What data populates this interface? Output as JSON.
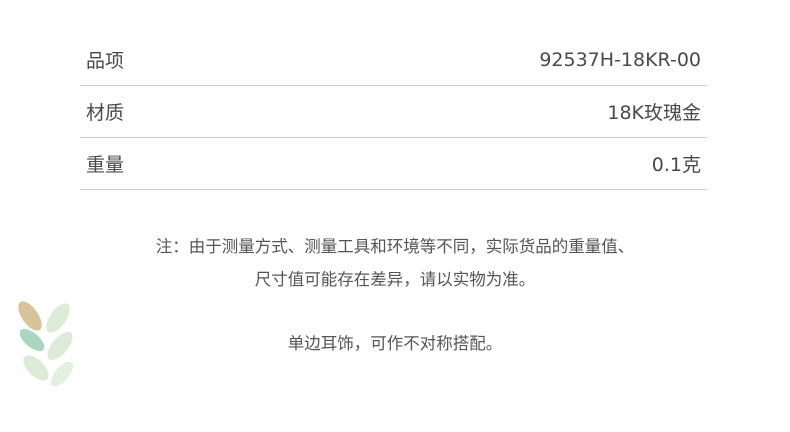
{
  "specs": [
    {
      "label": "品项",
      "value": "92537H-18KR-00"
    },
    {
      "label": "材质",
      "value": "18K玫瑰金"
    },
    {
      "label": "重量",
      "value": "0.1克"
    }
  ],
  "notes": {
    "line1": "注：由于测量方式、测量工具和环境等不同，实际货品的重量值、",
    "line2": "尺寸值可能存在差异，请以实物为准。",
    "line3": "单边耳饰，可作不对称搭配。"
  },
  "decor": {
    "icon": "leaf-sprig-icon",
    "colors": [
      "#d9c39a",
      "#a9d6c0",
      "#dcebd8"
    ]
  }
}
